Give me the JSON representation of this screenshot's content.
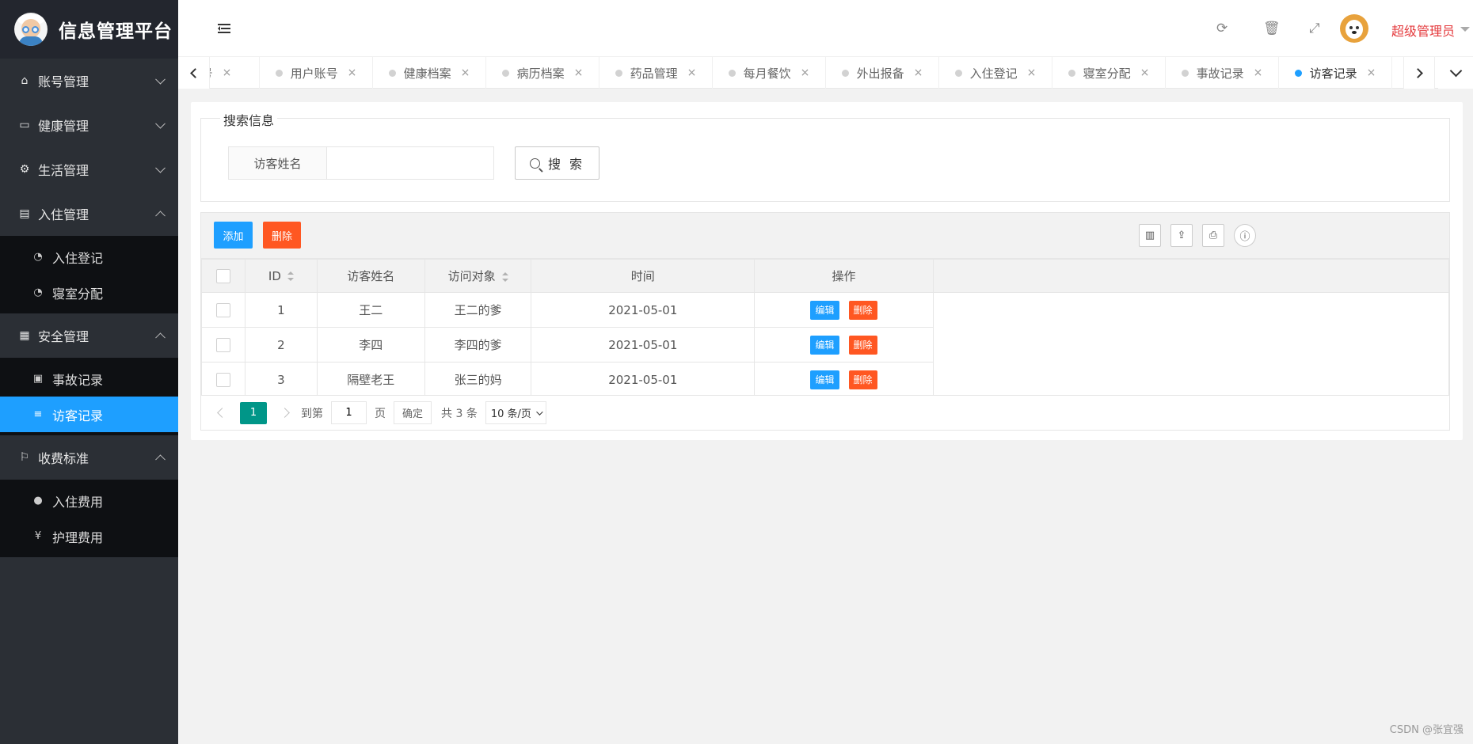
{
  "app": {
    "title": "信息管理平台",
    "user_name": "超级管理员"
  },
  "sidebar": {
    "groups": [
      {
        "label": "账号管理",
        "icon": "home-icon",
        "expanded": false
      },
      {
        "label": "健康管理",
        "icon": "window-icon",
        "expanded": false
      },
      {
        "label": "生活管理",
        "icon": "gears-icon",
        "expanded": false
      },
      {
        "label": "入住管理",
        "icon": "file-icon",
        "expanded": true,
        "items": [
          {
            "label": "入住登记",
            "icon": "dashboard-icon"
          },
          {
            "label": "寝室分配",
            "icon": "dashboard-icon"
          }
        ]
      },
      {
        "label": "安全管理",
        "icon": "calendar-icon",
        "expanded": true,
        "items": [
          {
            "label": "事故记录",
            "icon": "list-alt-icon"
          },
          {
            "label": "访客记录",
            "icon": "bars-icon",
            "active": true
          }
        ]
      },
      {
        "label": "收费标准",
        "icon": "flag-icon",
        "expanded": true,
        "items": [
          {
            "label": "入住费用",
            "icon": "arrow-circle-icon"
          },
          {
            "label": "护理费用",
            "icon": "yen-icon"
          }
        ]
      }
    ]
  },
  "header": {
    "icons": [
      "refresh-icon",
      "trash-icon",
      "fullscreen-icon"
    ]
  },
  "tabs": {
    "items": [
      {
        "label": "账号"
      },
      {
        "label": "用户账号"
      },
      {
        "label": "健康档案"
      },
      {
        "label": "病历档案"
      },
      {
        "label": "药品管理"
      },
      {
        "label": "每月餐饮"
      },
      {
        "label": "外出报备"
      },
      {
        "label": "入住登记"
      },
      {
        "label": "寝室分配"
      },
      {
        "label": "事故记录"
      },
      {
        "label": "访客记录",
        "active": true
      }
    ],
    "close_glyph": "×"
  },
  "search": {
    "legend": "搜索信息",
    "label": "访客姓名",
    "value": "",
    "placeholder": "",
    "button_label": "搜 索"
  },
  "toolbar": {
    "add_label": "添加",
    "delete_label": "删除",
    "tools": [
      "columns-icon",
      "export-icon",
      "print-icon",
      "info-icon"
    ]
  },
  "table": {
    "headers": [
      "ID",
      "访客姓名",
      "访问对象",
      "时间",
      "操作"
    ],
    "rows": [
      {
        "id": "1",
        "name": "王二",
        "target": "王二的爹",
        "time": "2021-05-01"
      },
      {
        "id": "2",
        "name": "李四",
        "target": "李四的爹",
        "time": "2021-05-01"
      },
      {
        "id": "3",
        "name": "隔壁老王",
        "target": "张三的妈",
        "time": "2021-05-01"
      }
    ],
    "row_actions": {
      "edit": "编辑",
      "delete": "删除"
    }
  },
  "pager": {
    "current_page": "1",
    "goto_label": "到第",
    "goto_value": "1",
    "page_unit": "页",
    "confirm_label": "确定",
    "total_label": "共 3 条",
    "page_size_label": "10 条/页"
  },
  "watermark": "CSDN @张宜强",
  "colors": {
    "sidebar_bg": "#2b2f35",
    "active_blue": "#1e9fff",
    "danger_orange": "#ff5722",
    "pager_green": "#009688",
    "username_red": "#e4393c"
  }
}
